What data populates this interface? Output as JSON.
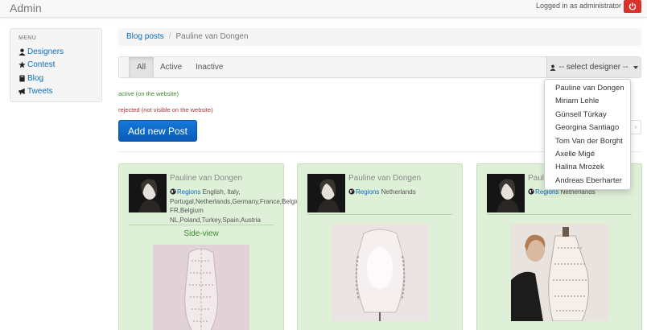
{
  "navbar": {
    "brand": "Admin",
    "logged_in": "Logged in as administrator"
  },
  "sidebar": {
    "heading": "MENU",
    "items": [
      {
        "label": "Designers",
        "icon": "user-icon"
      },
      {
        "label": "Contest",
        "icon": "star-icon"
      },
      {
        "label": "Blog",
        "icon": "book-icon"
      },
      {
        "label": "Tweets",
        "icon": "bullhorn-icon"
      }
    ]
  },
  "breadcrumb": {
    "root": "Blog posts",
    "separator": "/",
    "current": "Pauline van Dongen"
  },
  "filters": {
    "tabs": [
      "All",
      "Active",
      "Inactive"
    ],
    "active_tab": "All",
    "designer_select": "-- select designer --"
  },
  "legend": {
    "active": "active (on the website)",
    "rejected": "rejected (not visible on the website)"
  },
  "add_button": "Add new Post",
  "pager_next": "›",
  "posts": [
    {
      "designer": "Pauline van Dongen",
      "regions_label": "Regions",
      "regions": "English, Italy, Portugal,Netherlands,Germany,France,Belgium FR,Belgium NL,Poland,Turkey,Spain,Austria",
      "title": "Side-view"
    },
    {
      "designer": "Pauline van Dongen",
      "regions_label": "Regions",
      "regions": "Netherlands",
      "title": ""
    },
    {
      "designer": "Pauline van Dongen",
      "regions_label": "Regions",
      "regions": "Netherlands",
      "title": ""
    }
  ],
  "dropdown": {
    "options": [
      "Pauline van Dongen",
      "Miriam Lehle",
      "Günsell Türkay",
      "Georgina Santiago",
      "Tom Van der Borght",
      "Axelle Migé",
      "Halina Mrożek",
      "Andreas Eberharter"
    ]
  },
  "colors": {
    "accent": "#0a6ebd",
    "active_card_bg": "#dff0d8",
    "active_text": "#3c8a2e",
    "rejected_text": "#aa3333",
    "power_button": "#d9312b",
    "primary_button": "#0b5cb8"
  }
}
